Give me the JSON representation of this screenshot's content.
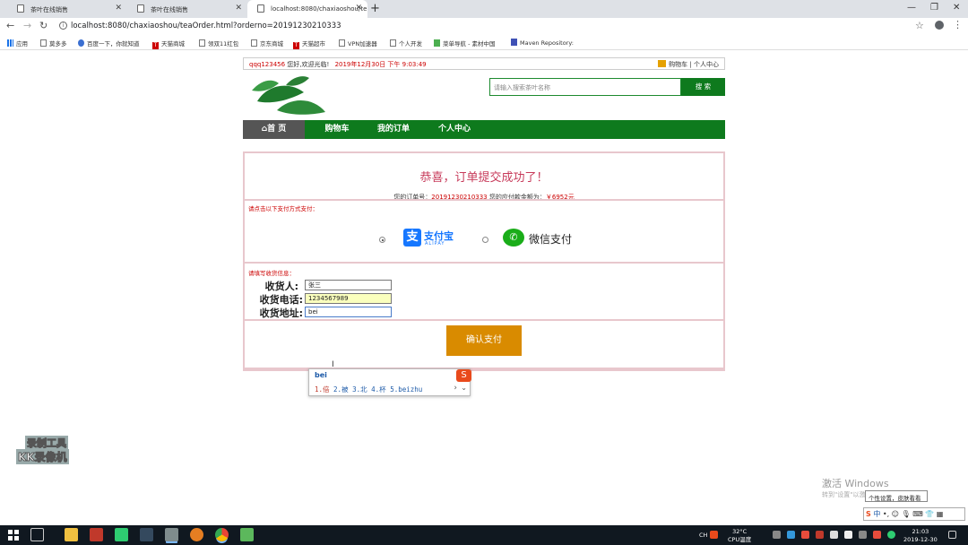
{
  "browser": {
    "tabs": [
      {
        "title": "茶叶在线销售",
        "active": false
      },
      {
        "title": "茶叶在线销售",
        "active": false
      },
      {
        "title": "localhost:8080/chaxiaoshou/te",
        "active": true
      }
    ],
    "url": "localhost:8080/chaxiaoshou/teaOrder.html?orderno=20191230210333",
    "bookmarks": [
      "应用",
      "莫多多",
      "百度一下，你就知道",
      "天猫商城",
      "领双11红包",
      "京东商城",
      "天猫超市",
      "VPN加速器",
      "个人开发",
      "菜单导航 - 素材中国",
      "Maven Repository:"
    ]
  },
  "topbar": {
    "username": "qqq123456",
    "welcome": "您好,欢迎光临!",
    "datetime": "2019年12月30日 下午 9:03:49",
    "cart": "购物车",
    "divider": "|",
    "profile": "个人中心"
  },
  "search": {
    "placeholder": "请输入搜索茶叶名称",
    "button": "搜 索"
  },
  "nav": {
    "home": "首 页",
    "cart": "购物车",
    "orders": "我的订单",
    "profile": "个人中心"
  },
  "order": {
    "title": "恭喜，订单提交成功了！",
    "number_label": "您的订单号：",
    "number": "20191230210333",
    "amount_label": "您的应付款金额为：",
    "amount": "￥6952元"
  },
  "payment": {
    "hint": "请点击以下支付方式支付：",
    "alipay": "支付宝",
    "alipay_sub": "ALIPAY",
    "wechat": "微信支付",
    "selected": "alipay"
  },
  "receiver": {
    "hint": "请填写收货信息：",
    "name_label": "收货人:",
    "name": "张三",
    "phone_label": "收货电话:",
    "phone": "1234567989",
    "address_label": "收货地址:",
    "address": "bei"
  },
  "pay_button": "确认支付",
  "ime": {
    "composition": "bei",
    "candidates": [
      "1.倍",
      "2.被",
      "3.北",
      "4.杯",
      "5.beizhu"
    ]
  },
  "watermark": {
    "line1": "录制工具",
    "line2": "KK录像机"
  },
  "activation": {
    "title": "激活 Windows",
    "subtitle": "转到\"设置\"以激活 Windows。",
    "tooltip": "个性设置，皮肤看看"
  },
  "taskbar": {
    "temp": "32°C",
    "temp_label": "CPU温度",
    "time": "21:03",
    "date": "2019-12-30"
  }
}
